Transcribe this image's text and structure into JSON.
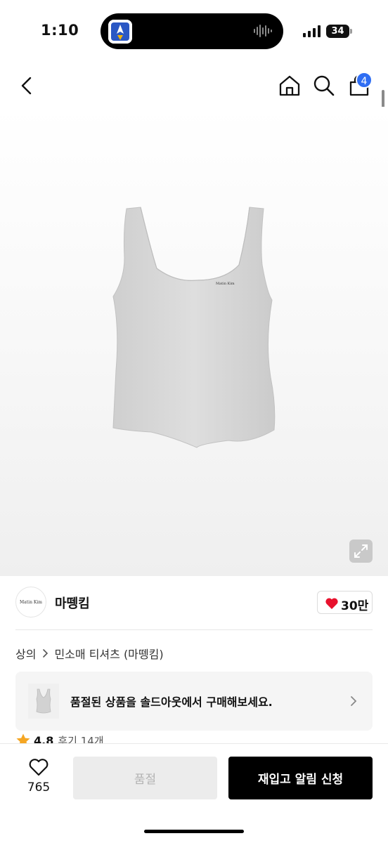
{
  "status_bar": {
    "time": "1:10",
    "battery_level": "34"
  },
  "header": {
    "cart_count": "4",
    "icons": [
      "back-icon",
      "home-icon",
      "search-icon",
      "cart-icon"
    ]
  },
  "product": {
    "image_alt": "민소매 티셔츠",
    "print_text": "Matin  Kim"
  },
  "brand": {
    "logo_text": "Matin  Kim",
    "name": "마뗑킴",
    "likes": "30만"
  },
  "breadcrumb": {
    "items": [
      "상의",
      "민소매 티셔츠 (마뗑킴)"
    ]
  },
  "soldout_banner": {
    "text": "품절된 상품을 솔드아웃에서 구매해보세요."
  },
  "rating": {
    "score": "4.8",
    "reviews": "후기 14개"
  },
  "bottom_bar": {
    "wish_count": "765",
    "soldout_label": "품절",
    "restock_label": "재입고 알림 신청"
  },
  "colors": {
    "badge": "#2f6ef3",
    "heart": "#e8112d",
    "star": "#f5a623",
    "primary_button": "#000000",
    "disabled_button": "#ececec"
  }
}
